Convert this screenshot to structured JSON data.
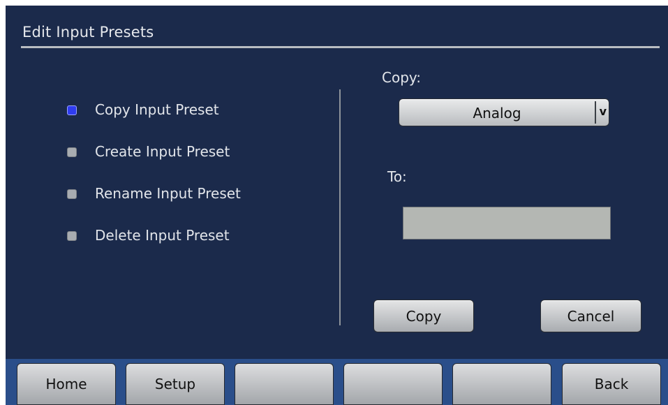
{
  "window": {
    "title": "Edit Input Presets"
  },
  "options": [
    {
      "label": "Copy Input Preset",
      "selected": true
    },
    {
      "label": "Create Input Preset",
      "selected": false
    },
    {
      "label": "Rename Input Preset",
      "selected": false
    },
    {
      "label": "Delete Input Preset",
      "selected": false
    }
  ],
  "copy_panel": {
    "copy_label": "Copy:",
    "copy_value": "Analog",
    "dropdown_arrow": "v",
    "to_label": "To:",
    "to_value": ""
  },
  "actions": {
    "copy": "Copy",
    "cancel": "Cancel"
  },
  "nav": {
    "home": "Home",
    "setup": "Setup",
    "back": "Back"
  },
  "colors": {
    "background": "#1b2a4b",
    "nav_bar": "#2a4e8a",
    "selected_radio": "#2f3cf0",
    "unselected_radio": "#a8acb1"
  }
}
